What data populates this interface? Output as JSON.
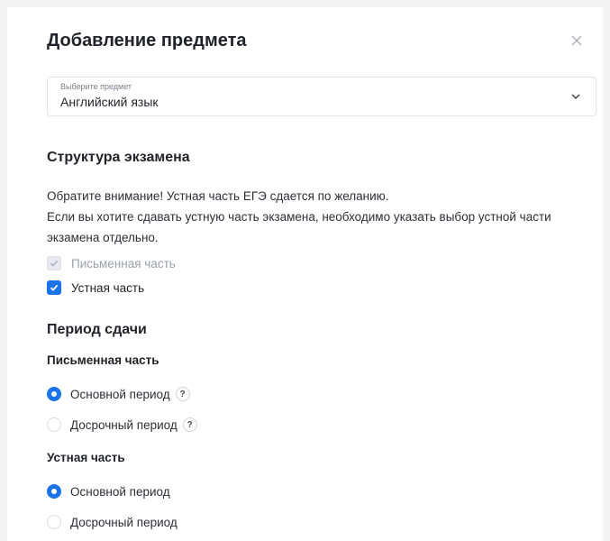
{
  "dialog": {
    "title": "Добавление предмета",
    "close_icon": "close-icon"
  },
  "subject_select": {
    "label": "Выберите предмет",
    "value": "Английский язык",
    "chevron_icon": "chevron-down-icon"
  },
  "exam_structure": {
    "heading": "Структура экзамена",
    "notice_lines": [
      "Обратите внимание! Устная часть ЕГЭ сдается по желанию.",
      "Если вы хотите сдавать устную часть экзамена, необходимо указать выбор устной части",
      "экзамена отдельно."
    ],
    "parts": [
      {
        "label": "Письменная часть",
        "checked": true,
        "disabled": true
      },
      {
        "label": "Устная часть",
        "checked": true,
        "disabled": false
      }
    ]
  },
  "period": {
    "heading": "Период сдачи",
    "written": {
      "heading": "Письменная часть",
      "options": [
        {
          "label": "Основной период",
          "selected": true,
          "help": "?"
        },
        {
          "label": "Досрочный период",
          "selected": false,
          "help": "?"
        }
      ]
    },
    "oral": {
      "heading": "Устная часть",
      "options": [
        {
          "label": "Основной период",
          "selected": true
        },
        {
          "label": "Досрочный период",
          "selected": false
        }
      ]
    }
  },
  "colors": {
    "accent": "#1a73e8",
    "muted_text": "#9aa1ab",
    "border": "#e1e4ea"
  }
}
